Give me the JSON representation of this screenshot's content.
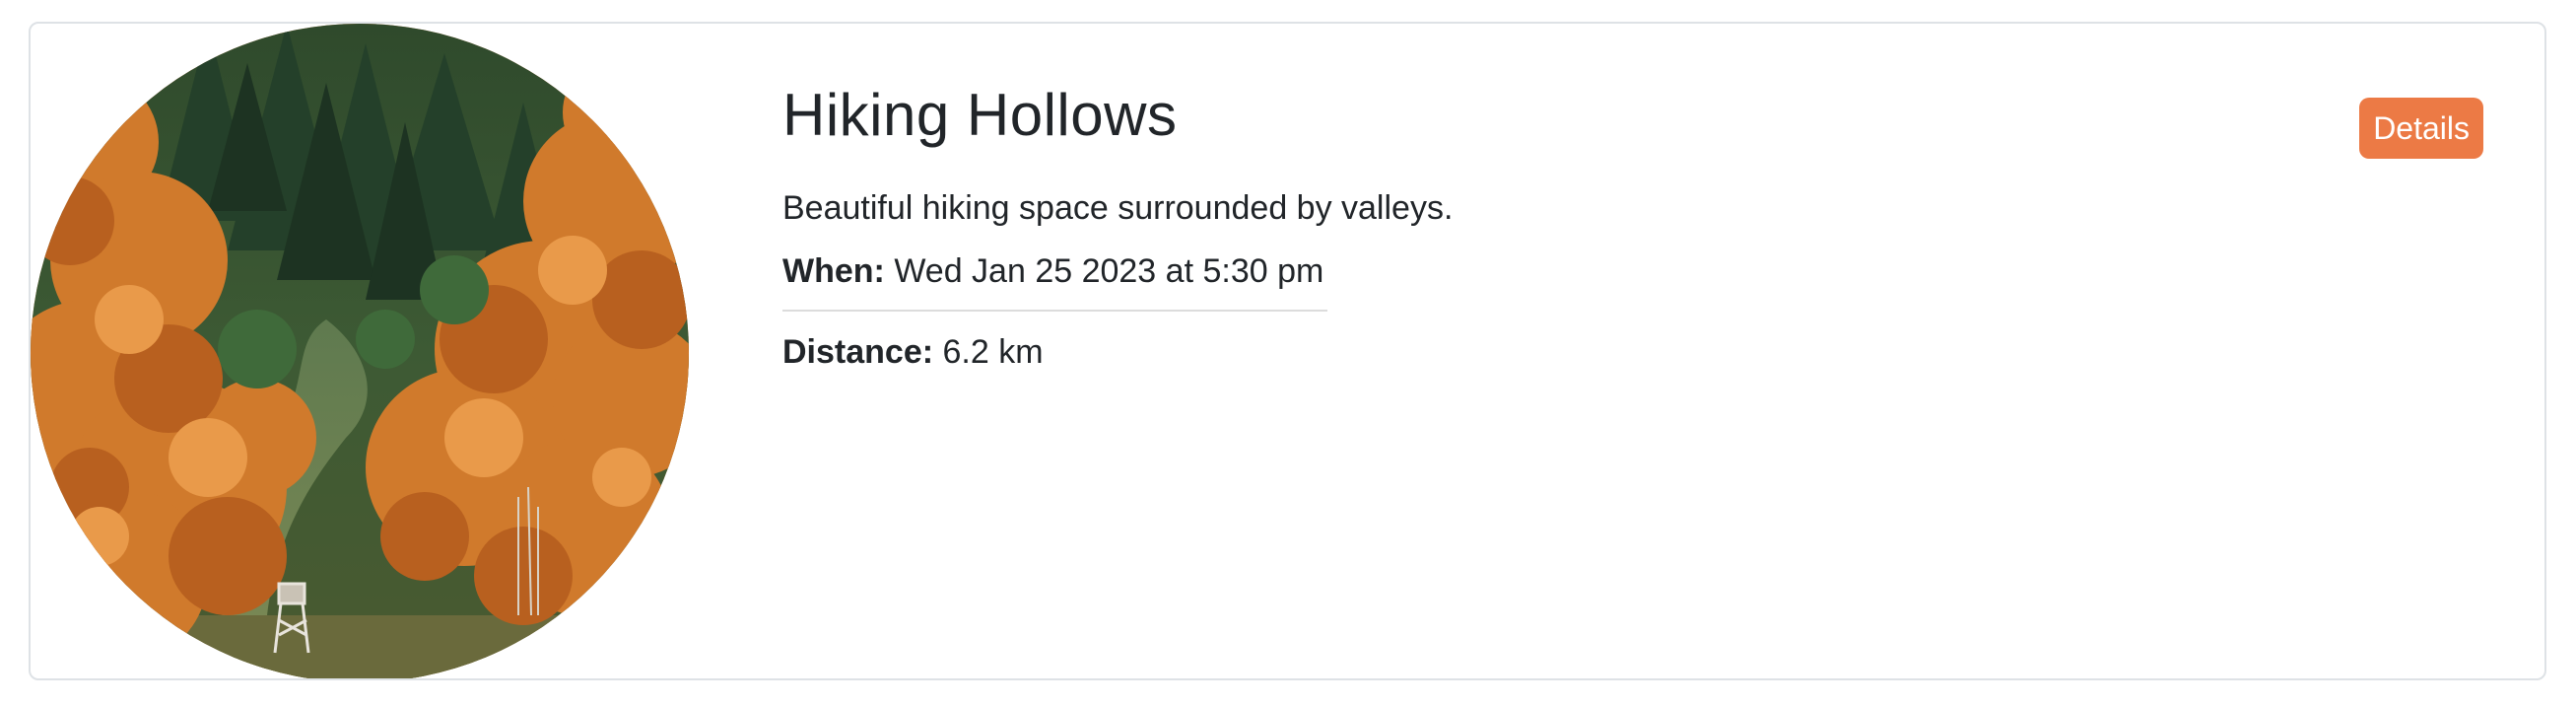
{
  "card": {
    "title": "Hiking Hollows",
    "description": "Beautiful hiking space surrounded by valleys.",
    "when": {
      "label": "When:",
      "value": "Wed Jan 25 2023 at 5:30 pm"
    },
    "distance": {
      "label": "Distance:",
      "value": "6.2 km"
    },
    "details_button_label": "Details",
    "colors": {
      "accent": "#ec7a45",
      "border": "#dee2e6",
      "text": "#212529"
    }
  },
  "image": {
    "icon": "autumn-forest-photo"
  }
}
